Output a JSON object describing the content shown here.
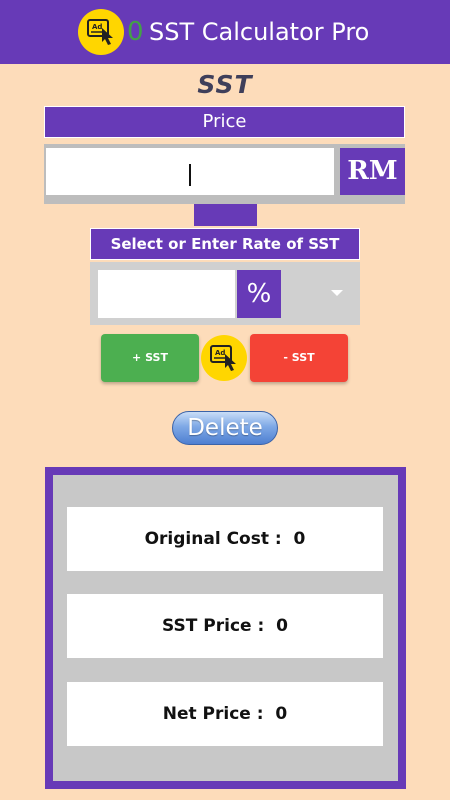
{
  "app_bar": {
    "ad_icon": "ad-cursor-icon",
    "ad_count": "0",
    "title": "SST Calculator Pro",
    "background_color": "#673AB7"
  },
  "logo_text": "SST",
  "price": {
    "header": "Price",
    "input_value": "",
    "currency_label": "RM"
  },
  "rate": {
    "header": "Select or Enter Rate of SST",
    "input_value": "",
    "percent_label": "%",
    "dropdown_icon": "dropdown-triangle-icon"
  },
  "actions": {
    "add_label": "+ SST",
    "subtract_label": "- SST",
    "add_color": "#4CAF50",
    "subtract_color": "#F44336",
    "ad_icon": "ad-cursor-icon"
  },
  "delete_label": "Delete",
  "results": [
    {
      "label": "Original Cost :",
      "value": "0"
    },
    {
      "label": "SST Price :",
      "value": "0"
    },
    {
      "label": "Net Price :",
      "value": "0"
    }
  ],
  "colors": {
    "page_background": "#FDDCBA",
    "accent": "#673AB7",
    "ad_badge": "#FFD600"
  }
}
